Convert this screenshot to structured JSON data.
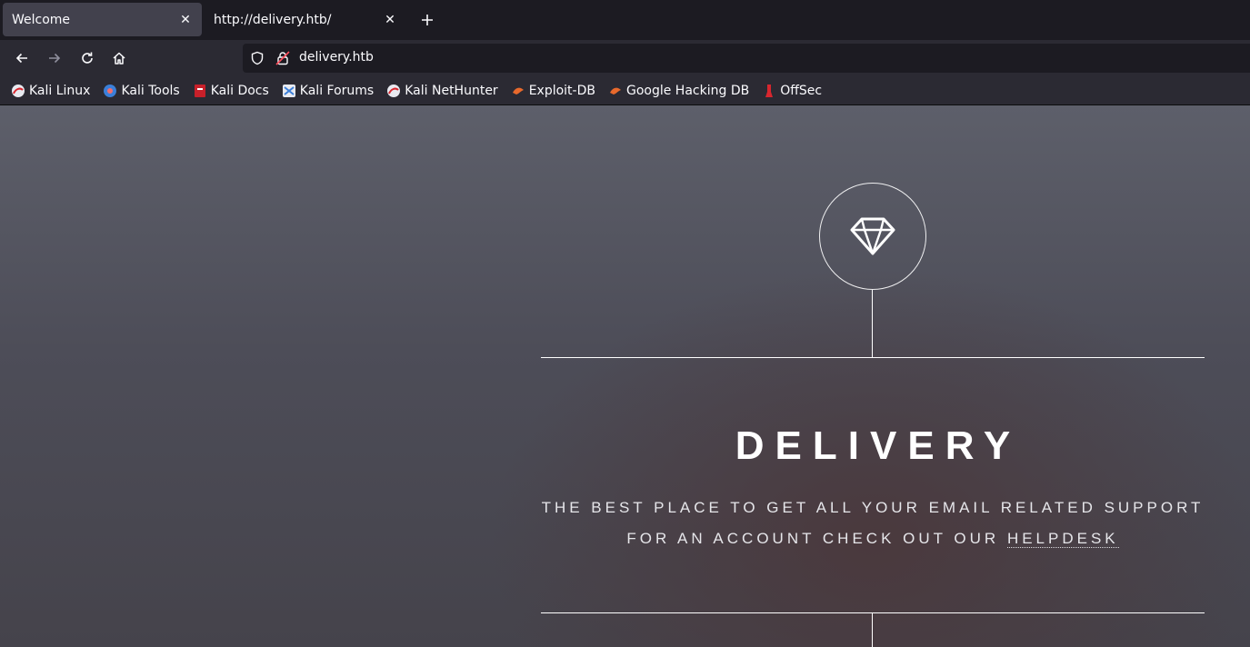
{
  "tabs": [
    {
      "title": "Welcome",
      "active": true
    },
    {
      "title": "http://delivery.htb/",
      "active": false
    }
  ],
  "nav": {
    "url": "delivery.htb"
  },
  "bookmarks": [
    {
      "label": "Kali Linux",
      "icon": "kali-dragon-icon"
    },
    {
      "label": "Kali Tools",
      "icon": "kali-tools-icon"
    },
    {
      "label": "Kali Docs",
      "icon": "kali-docs-icon"
    },
    {
      "label": "Kali Forums",
      "icon": "kali-forums-icon"
    },
    {
      "label": "Kali NetHunter",
      "icon": "kali-nethunter-icon"
    },
    {
      "label": "Exploit-DB",
      "icon": "exploit-db-icon"
    },
    {
      "label": "Google Hacking DB",
      "icon": "ghdb-icon"
    },
    {
      "label": "OffSec",
      "icon": "offsec-icon"
    }
  ],
  "page": {
    "title": "DELIVERY",
    "tagline_line1": "THE BEST PLACE TO GET ALL YOUR EMAIL RELATED SUPPORT",
    "tagline_line2_prefix": "FOR AN ACCOUNT CHECK OUT OUR ",
    "helpdesk_link": "HELPDESK",
    "logo_icon": "diamond-icon"
  },
  "colors": {
    "tab_bg": "#1c1b22",
    "active_tab": "#42414d",
    "toolbar": "#2b2a33",
    "text": "#fbfbfe"
  }
}
